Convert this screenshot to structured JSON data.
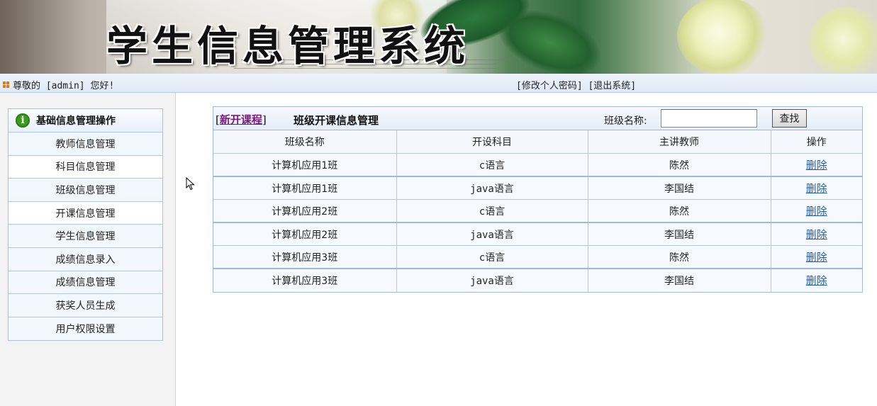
{
  "banner": {
    "title": "学生信息管理系统"
  },
  "topbar": {
    "greeting": "尊敬的 [admin] 您好!",
    "change_password": "[修改个人密码]",
    "logout": "[退出系统]"
  },
  "sidebar": {
    "header": "基础信息管理操作",
    "info_icon_glyph": "i",
    "items": [
      {
        "label": "教师信息管理"
      },
      {
        "label": "科目信息管理"
      },
      {
        "label": "班级信息管理"
      },
      {
        "label": "开课信息管理"
      },
      {
        "label": "学生信息管理"
      },
      {
        "label": "成绩信息录入"
      },
      {
        "label": "成绩信息管理"
      },
      {
        "label": "获奖人员生成"
      },
      {
        "label": "用户权限设置"
      }
    ]
  },
  "main": {
    "new_course_open": "[",
    "new_course_link": "新开课程",
    "new_course_close": "]",
    "title": "班级开课信息管理",
    "search_label": "班级名称:",
    "search_value": "",
    "search_button": "查找",
    "columns": [
      "班级名称",
      "开设科目",
      "主讲教师",
      "操作"
    ],
    "rows": [
      {
        "class_name": "计算机应用1班",
        "subject": "c语言",
        "teacher": "陈然",
        "action": "删除"
      },
      {
        "class_name": "计算机应用1班",
        "subject": "java语言",
        "teacher": "李国结",
        "action": "删除"
      },
      {
        "class_name": "计算机应用2班",
        "subject": "c语言",
        "teacher": "陈然",
        "action": "删除"
      },
      {
        "class_name": "计算机应用2班",
        "subject": "java语言",
        "teacher": "李国结",
        "action": "删除"
      },
      {
        "class_name": "计算机应用3班",
        "subject": "c语言",
        "teacher": "陈然",
        "action": "删除"
      },
      {
        "class_name": "计算机应用3班",
        "subject": "java语言",
        "teacher": "李国结",
        "action": "删除"
      }
    ]
  },
  "colors": {
    "border_blue": "#9fb8dc",
    "link_blue": "#1f5fb0",
    "link_purple": "#7a1a7a",
    "info_green": "#3c9a1e",
    "bullet_orange": "#e07a10"
  }
}
